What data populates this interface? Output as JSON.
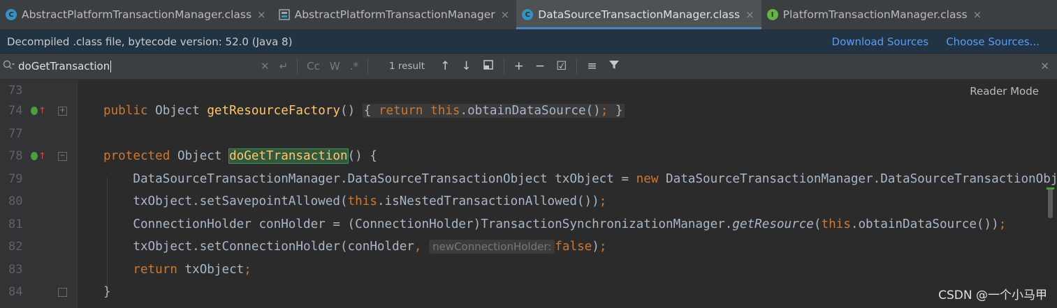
{
  "tabs": [
    {
      "label": "AbstractPlatformTransactionManager.class",
      "icon": "class-icon",
      "active": false
    },
    {
      "label": "AbstractPlatformTransactionManager",
      "icon": "structure-icon",
      "active": false
    },
    {
      "label": "DataSourceTransactionManager.class",
      "icon": "class-icon",
      "active": true
    },
    {
      "label": "PlatformTransactionManager.class",
      "icon": "interface-icon",
      "active": false
    }
  ],
  "close_glyph": "×",
  "banner": {
    "text": "Decompiled .class file, bytecode version: 52.0 (Java 8)",
    "download_sources": "Download Sources",
    "choose_sources": "Choose Sources..."
  },
  "search": {
    "query": "doGetTransaction",
    "result_count": "1 result",
    "match_case": "Cc",
    "words": "W",
    "regex": ".*"
  },
  "editor": {
    "reader_mode": "Reader Mode",
    "line_numbers": [
      "73",
      "74",
      "77",
      "78",
      "79",
      "80",
      "81",
      "82",
      "83",
      "84"
    ],
    "inlay_hint": "newConnectionHolder:",
    "tokens": {
      "public": "public",
      "protected": "protected",
      "object": "Object",
      "getResourceFactory": "getResourceFactory",
      "doGetTransaction": "doGetTransaction",
      "return": "return",
      "this": "this",
      "new": "new",
      "false": "false"
    }
  },
  "watermark": "CSDN @一个小马甲",
  "colors": {
    "keyword": "#cc7832",
    "method": "#ffc66d",
    "text": "#a9b7c6",
    "accent": "#4a88c7",
    "link": "#589df6"
  }
}
